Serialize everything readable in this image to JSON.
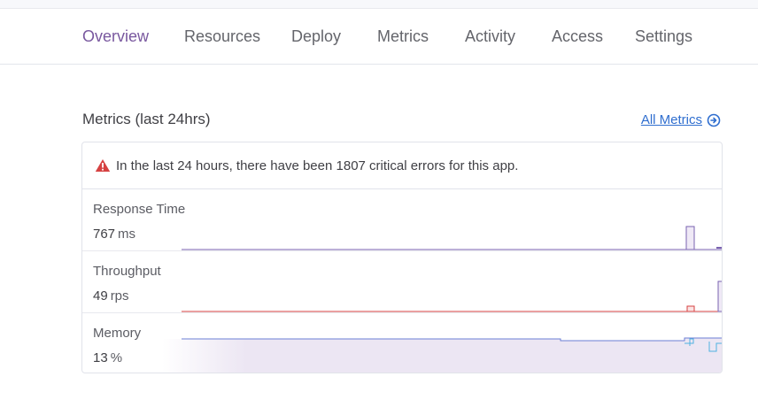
{
  "nav": {
    "tabs": [
      {
        "label": "Overview",
        "active": true
      },
      {
        "label": "Resources"
      },
      {
        "label": "Deploy"
      },
      {
        "label": "Metrics"
      },
      {
        "label": "Activity"
      },
      {
        "label": "Access"
      },
      {
        "label": "Settings"
      }
    ]
  },
  "metrics": {
    "title": "Metrics (last 24hrs)",
    "all_metrics_link": "All Metrics",
    "link_icon": "arrow-circle-right-icon",
    "alert": {
      "icon": "warning-triangle-icon",
      "text": "In the last 24 hours, there have been 1807 critical errors for this app."
    },
    "rows": [
      {
        "label": "Response Time",
        "value": "767",
        "unit": "ms"
      },
      {
        "label": "Throughput",
        "value": "49",
        "unit": "rps"
      },
      {
        "label": "Memory",
        "value": "13",
        "unit": "%"
      }
    ]
  },
  "colors": {
    "accent": "#79589f",
    "link": "#2f6ecf",
    "error": "#d64242",
    "memory_line": "#6b7fd6",
    "memory_fill": "#ece6f3"
  }
}
